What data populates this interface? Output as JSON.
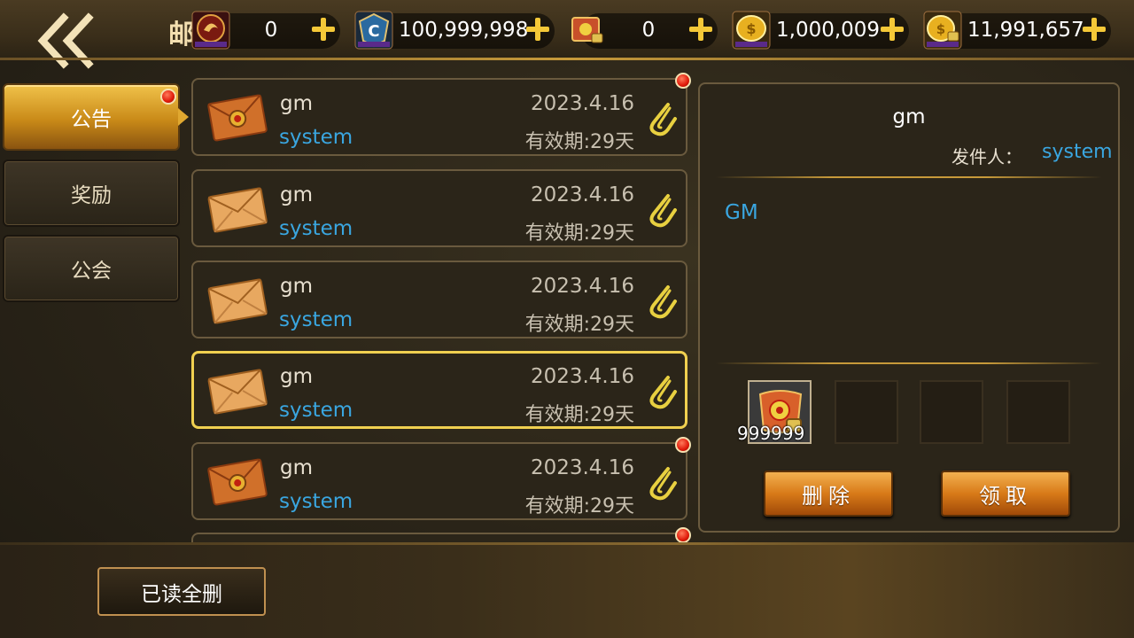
{
  "header": {
    "title_glyph": "邮",
    "currencies": [
      {
        "icon": "dragon-token-icon",
        "value": "0"
      },
      {
        "icon": "c-shield-gem-icon",
        "value": "100,999,998"
      },
      {
        "icon": "locked-scroll-icon",
        "value": "0"
      },
      {
        "icon": "gold-coin-icon",
        "value": "1,000,009"
      },
      {
        "icon": "locked-gold-coin-icon",
        "value": "11,991,657"
      }
    ]
  },
  "tabs": [
    {
      "label": "公告",
      "active": true,
      "has_notice": true
    },
    {
      "label": "奖励",
      "active": false,
      "has_notice": false
    },
    {
      "label": "公会",
      "active": false,
      "has_notice": false
    }
  ],
  "mails": [
    {
      "name": "gm",
      "from": "system",
      "date": "2023.4.16",
      "expiry": "有效期:29天",
      "state": "unread",
      "has_attachment": true
    },
    {
      "name": "gm",
      "from": "system",
      "date": "2023.4.16",
      "expiry": "有效期:29天",
      "state": "read",
      "has_attachment": true
    },
    {
      "name": "gm",
      "from": "system",
      "date": "2023.4.16",
      "expiry": "有效期:29天",
      "state": "read",
      "has_attachment": true
    },
    {
      "name": "gm",
      "from": "system",
      "date": "2023.4.16",
      "expiry": "有效期:29天",
      "state": "read-selected",
      "has_attachment": true
    },
    {
      "name": "gm",
      "from": "system",
      "date": "2023.4.16",
      "expiry": "有效期:29天",
      "state": "unread",
      "has_attachment": true
    }
  ],
  "detail": {
    "title": "gm",
    "sender_label": "发件人：",
    "sender": "system",
    "body": "GM",
    "attachments": [
      {
        "icon": "locked-scroll-icon",
        "quantity": "999999"
      }
    ],
    "delete_label": "删除",
    "claim_label": "领取"
  },
  "footer": {
    "delete_all_read_label": "已读全删"
  },
  "colors": {
    "accent_gold": "#f0c24a",
    "link_blue": "#3aa6e0",
    "selected_border": "#f0d050",
    "notice_red": "#e01a0a"
  }
}
